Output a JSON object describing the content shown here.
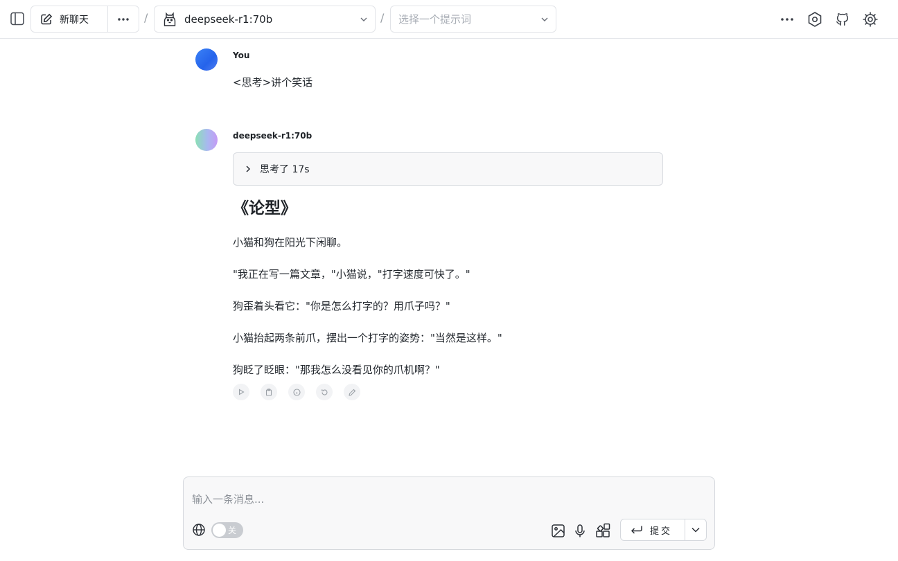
{
  "header": {
    "new_chat_label": "新聊天",
    "model_name": "deepseek-r1:70b",
    "prompt_placeholder": "选择一个提示词",
    "separator": "/",
    "icons": [
      "sidebar-toggle-icon",
      "edit-icon",
      "more-icon",
      "llama-icon",
      "chevron-down-icon",
      "settings-icon",
      "github-icon",
      "theme-settings-icon"
    ]
  },
  "messages": [
    {
      "sender": "You",
      "text": "<思考>讲个笑话"
    },
    {
      "sender": "deepseek-r1:70b",
      "thinking_label": "思考了 17s",
      "heading": "《论型》",
      "paragraphs": [
        "小猫和狗在阳光下闲聊。",
        "\"我正在写一篇文章，\"小猫说，\"打字速度可快了。\"",
        "狗歪着头看它：\"你是怎么打字的？用爪子吗？\"",
        "小猫抬起两条前爪，摆出一个打字的姿势：\"当然是这样。\"",
        "狗眨了眨眼：\"那我怎么没看见你的爪机啊？\""
      ],
      "actions": [
        "play-icon",
        "copy-icon",
        "info-icon",
        "regenerate-icon",
        "edit-icon"
      ]
    }
  ],
  "composer": {
    "placeholder": "输入一条消息...",
    "web_search_toggle_label": "关",
    "web_search_on": false,
    "submit_label": "提交"
  },
  "colors": {
    "user_avatar": "#3b82f6",
    "border": "#e2e4e8",
    "toggle_off": "#c9ccd1"
  }
}
